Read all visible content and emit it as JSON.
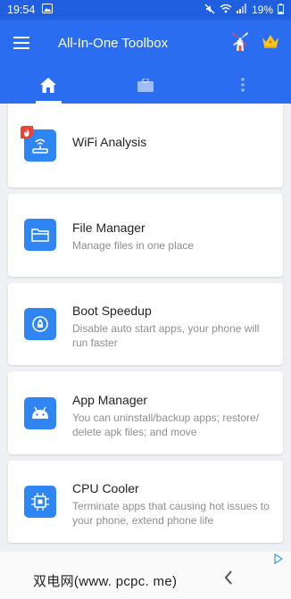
{
  "status_bar": {
    "time": "19:54",
    "battery": "19%"
  },
  "app_bar": {
    "title": "All-In-One Toolbox"
  },
  "tabs": [
    {
      "icon": "home-icon",
      "active": true
    },
    {
      "icon": "briefcase-icon",
      "active": false
    },
    {
      "icon": "more-vert-icon",
      "active": false
    }
  ],
  "tools": [
    {
      "title": "WiFi Analysis",
      "desc": "",
      "icon": "wifi-router-icon",
      "hot": true
    },
    {
      "title": "File Manager",
      "desc": "Manage files in one place",
      "icon": "folder-icon"
    },
    {
      "title": "Boot Speedup",
      "desc": "Disable auto start apps, your phone will run faster",
      "icon": "rocket-icon"
    },
    {
      "title": "App Manager",
      "desc": "You can uninstall/backup apps; restore/ delete apk files; and move",
      "icon": "android-icon"
    },
    {
      "title": "CPU Cooler",
      "desc": "Terminate apps that causing hot issues to your phone, extend phone life",
      "icon": "cpu-chip-icon"
    }
  ],
  "watermark": "双电网(www. pcpc. me)",
  "colors": {
    "primary": "#2a6df0",
    "icon_bg": "#2f86f2",
    "hot": "#ea4335",
    "crown": "#f5c518"
  }
}
